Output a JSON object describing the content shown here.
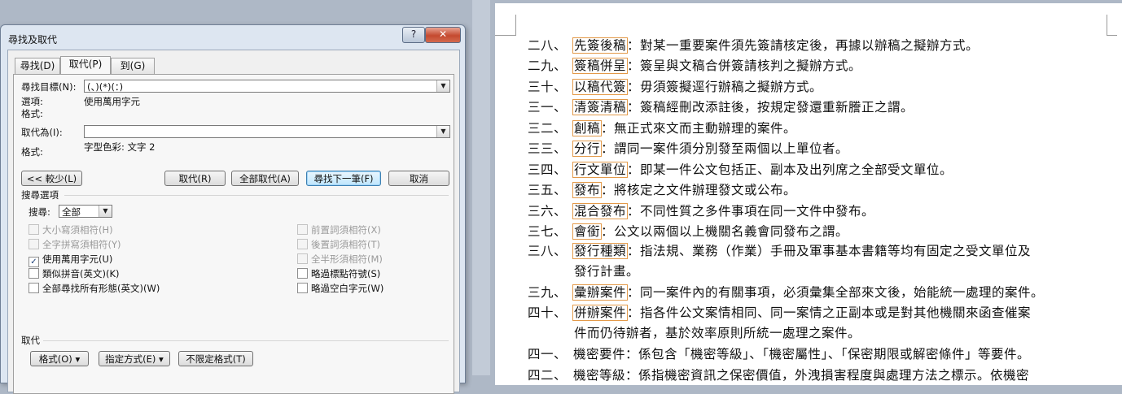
{
  "dialog": {
    "title": "尋找及取代",
    "help_label": "?",
    "close_label": "✕",
    "tabs": [
      {
        "label": "尋找(D)",
        "active": false
      },
      {
        "label": "取代(P)",
        "active": true
      },
      {
        "label": "到(G)",
        "active": false
      }
    ],
    "find_label": "尋找目標(N):",
    "find_value": "(、)(*)(：)",
    "options_label": "選項:",
    "options_value": "使用萬用字元",
    "format_label_1": "格式:",
    "replace_label": "取代為(I):",
    "replace_value": "",
    "format_label_2": "格式:",
    "format_value_2": "字型色彩: 文字 2",
    "buttons": {
      "less": "<< 較少(L)",
      "replace": "取代(R)",
      "replace_all": "全部取代(A)",
      "find_next": "尋找下一筆(F)",
      "cancel": "取消"
    },
    "search_options_title": "搜尋選項",
    "search_label": "搜尋:",
    "search_value": "全部",
    "checkboxes_left": [
      {
        "label": "大小寫須相符(H)",
        "checked": false,
        "disabled": true
      },
      {
        "label": "全字拼寫須相符(Y)",
        "checked": false,
        "disabled": true
      },
      {
        "label": "使用萬用字元(U)",
        "checked": true,
        "disabled": false
      },
      {
        "label": "類似拼音(英文)(K)",
        "checked": false,
        "disabled": false
      },
      {
        "label": "全部尋找所有形態(英文)(W)",
        "checked": false,
        "disabled": false
      }
    ],
    "checkboxes_right": [
      {
        "label": "前置詞須相符(X)",
        "checked": false,
        "disabled": true
      },
      {
        "label": "後置詞須相符(T)",
        "checked": false,
        "disabled": true
      },
      {
        "label": "全半形須相符(M)",
        "checked": false,
        "disabled": true
      },
      {
        "label": "略過標點符號(S)",
        "checked": false,
        "disabled": false
      },
      {
        "label": "略過空白字元(W)",
        "checked": false,
        "disabled": false
      }
    ],
    "replace_section_title": "取代",
    "bottom_buttons": {
      "format": "格式(O) ▾",
      "special": "指定方式(E) ▾",
      "no_format": "不限定格式(T)"
    },
    "check_mark": "✓"
  },
  "document": {
    "lines": [
      {
        "num": "二八、",
        "term": "先簽後稿",
        "rest": "：對某一重要案件須先簽請核定後，再據以辦稿之擬辦方式。"
      },
      {
        "num": "二九、",
        "term": "簽稿併呈",
        "rest": "：簽呈與文稿合併簽請核判之擬辦方式。"
      },
      {
        "num": "三十、",
        "term": "以稿代簽",
        "rest": "：毋須簽擬逕行辦稿之擬辦方式。"
      },
      {
        "num": "三一、",
        "term": "清簽清稿",
        "rest": "：簽稿經刪改添註後，按規定發還重新謄正之謂。"
      },
      {
        "num": "三二、",
        "term": "創稿",
        "rest": "：無正式來文而主動辦理的案件。"
      },
      {
        "num": "三三、",
        "term": "分行",
        "rest": "：謂同一案件須分別發至兩個以上單位者。"
      },
      {
        "num": "三四、",
        "term": "行文單位",
        "rest": "：即某一件公文包括正、副本及出列席之全部受文單位。"
      },
      {
        "num": "三五、",
        "term": "發布",
        "rest": "：將核定之文件辦理發文或公布。"
      },
      {
        "num": "三六、",
        "term": "混合發布",
        "rest": "：不同性質之多件事項在同一文件中發布。"
      },
      {
        "num": "三七、",
        "term": "會銜",
        "rest": "：公文以兩個以上機關名義會同發布之謂。"
      },
      {
        "num": "三八、",
        "term": "發行種類",
        "rest": "：指法規、業務（作業）手冊及軍事基本書籍等均有固定之受文單位及"
      },
      {
        "num": "",
        "term": "",
        "rest": "發行計畫。"
      },
      {
        "num": "三九、",
        "term": "彙辦案件",
        "rest": "：同一案件內的有關事項，必須彙集全部來文後，始能統一處理的案件。"
      },
      {
        "num": "四十、",
        "term": "併辦案件",
        "rest": "：指各件公文案情相同、同一案情之正副本或是對其他機關來函查催案"
      },
      {
        "num": "",
        "term": "",
        "rest": "件而仍待辦者，基於效率原則所統一處理之案件。"
      },
      {
        "num": "四一、",
        "term": "",
        "rest": "機密要件：係包含「機密等級」、「機密屬性」、「保密期限或解密條件」等要件。"
      },
      {
        "num": "四二、",
        "term": "",
        "rest": "機密等級：係指機密資訊之保密價值，外洩損害程度與處理方法之標示。依機密"
      }
    ]
  }
}
